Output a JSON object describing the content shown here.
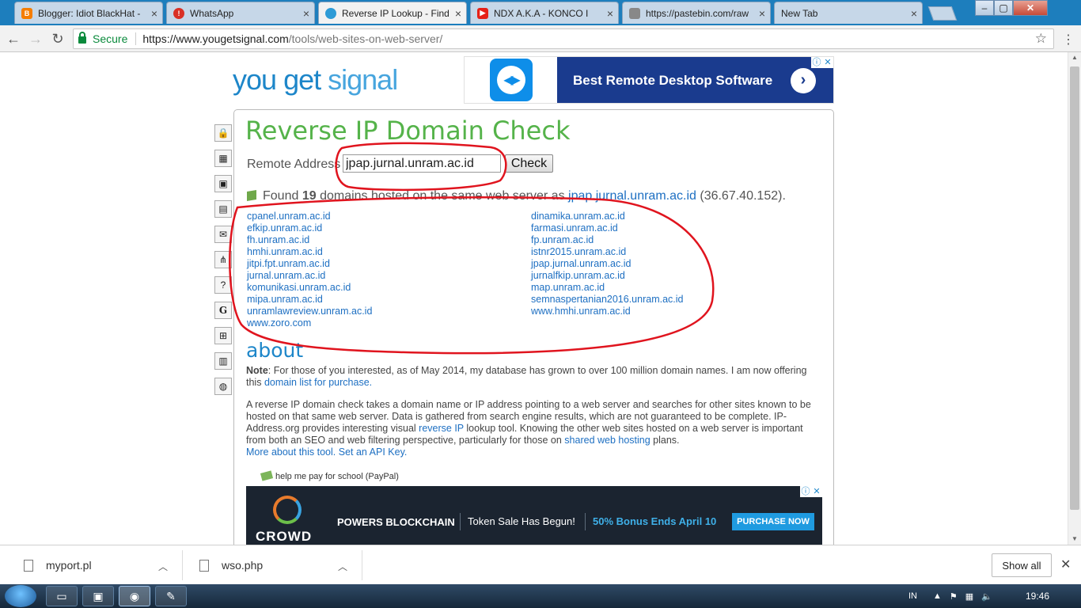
{
  "browser": {
    "tabs": [
      {
        "title": "Blogger: Idiot BlackHat -",
        "favicon_color": "#f57d00",
        "active": false
      },
      {
        "title": "WhatsApp",
        "favicon_color": "#d93025",
        "active": false
      },
      {
        "title": "Reverse IP Lookup - Find",
        "favicon_color": "#2e9bd6",
        "active": true
      },
      {
        "title": "NDX A.K.A - KONCO I",
        "favicon_color": "#e62117",
        "active": false
      },
      {
        "title": "https://pastebin.com/raw",
        "favicon_color": "#888888",
        "active": false
      },
      {
        "title": "New Tab",
        "favicon_color": "",
        "active": false
      }
    ],
    "secure_label": "Secure",
    "url_host": "https://www.yougetsignal.com",
    "url_path": "/tools/web-sites-on-web-server/"
  },
  "site": {
    "logo": {
      "you": "you",
      "get": "get",
      "signal": "signal"
    },
    "top_ad": {
      "headline": "Best Remote Desktop Software"
    },
    "title": "Reverse IP Domain Check",
    "remote_address_label": "Remote Address",
    "remote_address_value": "jpap.jurnal.unram.ac.id",
    "check_button": "Check",
    "found": {
      "prefix": "Found",
      "count": "19",
      "middle": "domains hosted on the same web server as",
      "domain": "jpap.jurnal.unram.ac.id",
      "ip": "(36.67.40.152)."
    },
    "domains_left": [
      "cpanel.unram.ac.id",
      "efkip.unram.ac.id",
      "fh.unram.ac.id",
      "hmhi.unram.ac.id",
      "jitpi.fpt.unram.ac.id",
      "jurnal.unram.ac.id",
      "komunikasi.unram.ac.id",
      "mipa.unram.ac.id",
      "unramlawreview.unram.ac.id",
      "www.zoro.com"
    ],
    "domains_right": [
      "dinamika.unram.ac.id",
      "farmasi.unram.ac.id",
      "fp.unram.ac.id",
      "istnr2015.unram.ac.id",
      "jpap.jurnal.unram.ac.id",
      "jurnalfkip.unram.ac.id",
      "map.unram.ac.id",
      "semnaspertanian2016.unram.ac.id",
      "www.hmhi.unram.ac.id"
    ],
    "about_heading": "about",
    "note": {
      "label": "Note",
      "text": ": For those of you interested, as of May 2014, my database has grown to over 100 million domain names. I am now offering this ",
      "link": "domain list for purchase."
    },
    "description": {
      "part1": "A reverse IP domain check takes a domain name or IP address pointing to a web server and searches for other sites known to be hosted on that same web server. Data is gathered from search engine results, which are not guaranteed to be complete. IP-Address.org provides interesting visual ",
      "link1": "reverse IP",
      "part2": " lookup tool. Knowing the other web sites hosted on a web server is important from both an SEO and web filtering perspective, particularly for those on ",
      "link2": "shared web hosting",
      "part3": " plans."
    },
    "more_link": "More about this tool.",
    "api_link": "Set an API Key.",
    "paypal": "help me pay for school (PayPal)",
    "bottom_ad": {
      "brand": "CROWD",
      "tagline": "POWERS BLOCKCHAIN",
      "sale": "Token Sale Has Begun!",
      "bonus": "50% Bonus Ends April 10",
      "cta": "PURCHASE NOW"
    }
  },
  "downloads": {
    "items": [
      "myport.pl",
      "wso.php"
    ],
    "show_all": "Show all"
  },
  "taskbar": {
    "lang": "IN",
    "clock": "19:46"
  },
  "colors": {
    "title_green": "#55b34a",
    "link_blue": "#1d6fc2",
    "annotation_red": "#e0141e"
  }
}
